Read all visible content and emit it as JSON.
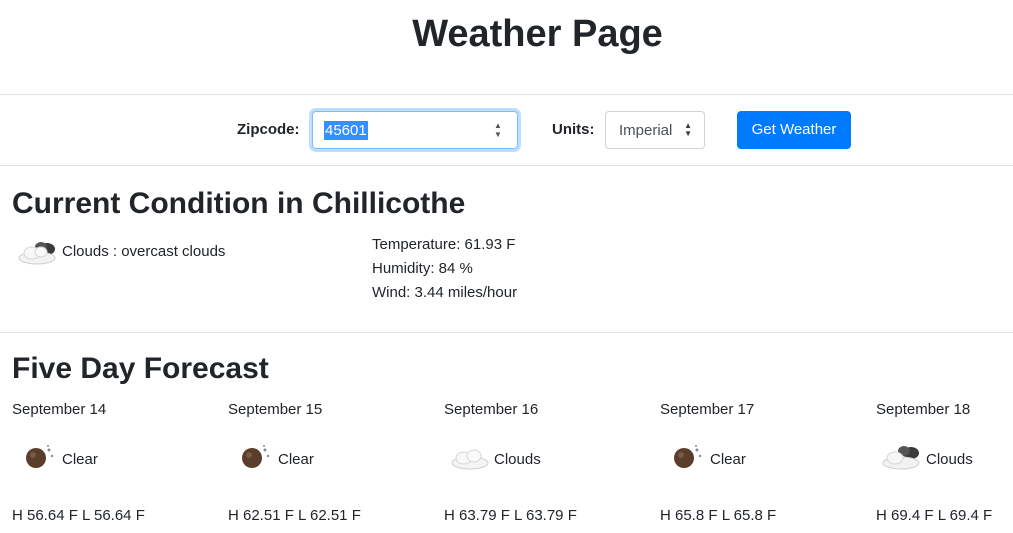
{
  "header": {
    "title": "Weather Page"
  },
  "form": {
    "zip_label": "Zipcode:",
    "zip_value": "45601",
    "units_label": "Units:",
    "units_value": "Imperial",
    "button_label": "Get Weather"
  },
  "current": {
    "heading": "Current Condition in Chillicothe",
    "icon": "cloud-icon",
    "condition": "Clouds : overcast clouds",
    "temperature": "Temperature: 61.93 F",
    "humidity": "Humidity: 84 %",
    "wind": "Wind: 3.44 miles/hour"
  },
  "forecast": {
    "heading": "Five Day Forecast",
    "days": [
      {
        "date": "September 14",
        "icon": "moon-clear-icon",
        "condition": "Clear",
        "hl": "H 56.64 F L 56.64 F"
      },
      {
        "date": "September 15",
        "icon": "moon-clear-icon",
        "condition": "Clear",
        "hl": "H 62.51 F L 62.51 F"
      },
      {
        "date": "September 16",
        "icon": "cloud-icon",
        "condition": "Clouds",
        "hl": "H 63.79 F L 63.79 F"
      },
      {
        "date": "September 17",
        "icon": "moon-clear-icon",
        "condition": "Clear",
        "hl": "H 65.8 F L 65.8 F"
      },
      {
        "date": "September 18",
        "icon": "dark-cloud-icon",
        "condition": "Clouds",
        "hl": "H 69.4 F L 69.4 F"
      }
    ]
  }
}
